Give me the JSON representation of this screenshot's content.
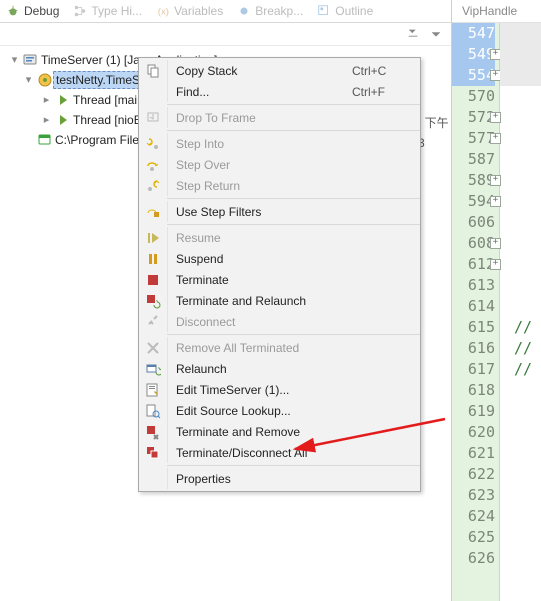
{
  "tabrow": {
    "items": [
      {
        "icon": "bug",
        "label": "Debug",
        "state": "current"
      },
      {
        "icon": "tree",
        "label": "Type Hi...",
        "state": "inactive"
      },
      {
        "icon": "vars",
        "label": "Variables",
        "state": "inactive"
      },
      {
        "icon": "bp",
        "label": "Breakp...",
        "state": "inactive"
      },
      {
        "icon": "outline",
        "label": "Outline",
        "state": "inactive"
      }
    ]
  },
  "tree": {
    "root": "TimeServer (1) [Java Application]",
    "selected": "testNetty.TimeSe",
    "thread1": "Thread [mai",
    "thread2": "Thread [nioE",
    "path": "C:\\Program Files",
    "tail": "] 下午3"
  },
  "menu": {
    "items": [
      {
        "icon": "copy",
        "label": "Copy Stack",
        "accel": "Ctrl+C",
        "enabled": true
      },
      {
        "icon": "",
        "label": "Find...",
        "accel": "Ctrl+F",
        "enabled": true
      },
      {
        "sep": true
      },
      {
        "icon": "dropframe",
        "label": "Drop To Frame",
        "enabled": false
      },
      {
        "sep": true
      },
      {
        "icon": "stepinto",
        "label": "Step Into",
        "enabled": false
      },
      {
        "icon": "stepover",
        "label": "Step Over",
        "enabled": false
      },
      {
        "icon": "stepret",
        "label": "Step Return",
        "enabled": false
      },
      {
        "sep": true
      },
      {
        "icon": "filter",
        "label": "Use Step Filters",
        "enabled": true
      },
      {
        "sep": true
      },
      {
        "icon": "resume",
        "label": "Resume",
        "enabled": false
      },
      {
        "icon": "suspend",
        "label": "Suspend",
        "enabled": true
      },
      {
        "icon": "terminate",
        "label": "Terminate",
        "enabled": true
      },
      {
        "icon": "termrel",
        "label": "Terminate and Relaunch",
        "enabled": true
      },
      {
        "icon": "disc",
        "label": "Disconnect",
        "enabled": false
      },
      {
        "sep": true
      },
      {
        "icon": "removeall",
        "label": "Remove All Terminated",
        "enabled": false
      },
      {
        "icon": "relaunch",
        "label": "Relaunch",
        "enabled": true
      },
      {
        "icon": "edit",
        "label": "Edit TimeServer (1)...",
        "enabled": true
      },
      {
        "icon": "srclookup",
        "label": "Edit Source Lookup...",
        "enabled": true
      },
      {
        "icon": "termrem",
        "label": "Terminate and Remove",
        "enabled": true
      },
      {
        "icon": "termall",
        "label": "Terminate/Disconnect All",
        "enabled": true
      },
      {
        "sep": true
      },
      {
        "icon": "",
        "label": "Properties",
        "enabled": true
      }
    ]
  },
  "right_tab": "VipHandle",
  "lines": [
    {
      "num": "547",
      "fold": false,
      "hl": true,
      "code": ""
    },
    {
      "num": "549",
      "fold": true,
      "hl": true,
      "code": ""
    },
    {
      "num": "554",
      "fold": true,
      "hl": true,
      "code": ""
    },
    {
      "num": "570",
      "fold": false,
      "hl": false,
      "code": ""
    },
    {
      "num": "572",
      "fold": true,
      "hl": false,
      "code": ""
    },
    {
      "num": "577",
      "fold": true,
      "hl": false,
      "code": ""
    },
    {
      "num": "587",
      "fold": false,
      "hl": false,
      "code": ""
    },
    {
      "num": "589",
      "fold": true,
      "hl": false,
      "code": ""
    },
    {
      "num": "594",
      "fold": true,
      "hl": false,
      "code": ""
    },
    {
      "num": "606",
      "fold": false,
      "hl": false,
      "code": ""
    },
    {
      "num": "608",
      "fold": true,
      "hl": false,
      "code": ""
    },
    {
      "num": "612",
      "fold": true,
      "hl": false,
      "code": ""
    },
    {
      "num": "613",
      "fold": false,
      "hl": false,
      "code": ""
    },
    {
      "num": "614",
      "fold": false,
      "hl": false,
      "code": ""
    },
    {
      "num": "615",
      "fold": false,
      "hl": false,
      "code": "//"
    },
    {
      "num": "616",
      "fold": false,
      "hl": false,
      "code": "//"
    },
    {
      "num": "617",
      "fold": false,
      "hl": false,
      "code": "//"
    },
    {
      "num": "618",
      "fold": false,
      "hl": false,
      "code": ""
    },
    {
      "num": "619",
      "fold": false,
      "hl": false,
      "code": ""
    },
    {
      "num": "620",
      "fold": false,
      "hl": false,
      "code": ""
    },
    {
      "num": "621",
      "fold": false,
      "hl": false,
      "code": ""
    },
    {
      "num": "622",
      "fold": false,
      "hl": false,
      "code": ""
    },
    {
      "num": "623",
      "fold": false,
      "hl": false,
      "code": ""
    },
    {
      "num": "624",
      "fold": false,
      "hl": false,
      "code": ""
    },
    {
      "num": "625",
      "fold": false,
      "hl": false,
      "code": ""
    },
    {
      "num": "626",
      "fold": false,
      "hl": false,
      "code": ""
    }
  ]
}
